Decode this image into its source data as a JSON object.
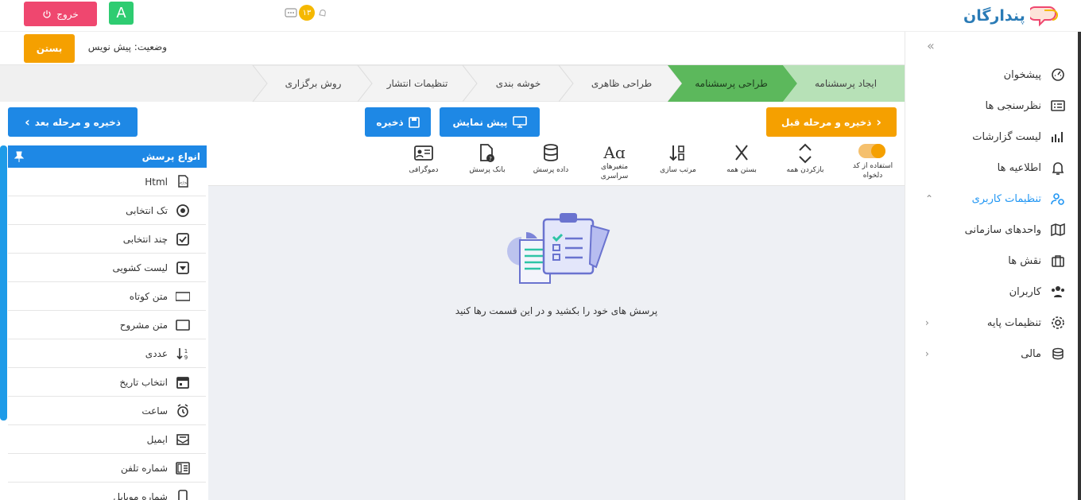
{
  "header": {
    "logout_label": "خروج",
    "avatar_letter": "A",
    "notification_count": "۱۳",
    "logo_text": "پندارگان"
  },
  "status": {
    "close_label": "بستن",
    "status_text": "وضعیت: پیش نویس"
  },
  "steps": [
    "ایجاد پرسشنامه",
    "طراحی پرسشنامه",
    "طراحی ظاهری",
    "خوشه بندی",
    "تنظیمات انتشار",
    "روش برگزاری"
  ],
  "actions": {
    "save_prev": "ذخیره و مرحله قبل",
    "preview": "پیش نمایش",
    "save": "ذخیره",
    "save_next": "ذخیره و مرحله بعد"
  },
  "tools": {
    "custom_code": "استفاده از کد دلخواه",
    "expand_all": "بازکردن همه",
    "collapse_all": "بستن همه",
    "sort": "مرتب سازی",
    "global_vars": "متغیرهای سراسری",
    "question_data": "داده پرسش",
    "question_bank": "بانک پرسش",
    "demographics": "دموگرافی"
  },
  "question_types": {
    "title": "انواع پرسش",
    "items": [
      {
        "label": "Html",
        "icon": "html-file-icon"
      },
      {
        "label": "تک انتخابی",
        "icon": "radio-icon"
      },
      {
        "label": "چند انتخابی",
        "icon": "checkbox-icon"
      },
      {
        "label": "لیست کشویی",
        "icon": "dropdown-icon"
      },
      {
        "label": "متن کوتاه",
        "icon": "short-text-icon"
      },
      {
        "label": "متن مشروح",
        "icon": "long-text-icon"
      },
      {
        "label": "عددی",
        "icon": "number-sort-icon"
      },
      {
        "label": "انتخاب تاریخ",
        "icon": "calendar-icon"
      },
      {
        "label": "ساعت",
        "icon": "alarm-clock-icon"
      },
      {
        "label": "ایمیل",
        "icon": "email-icon"
      },
      {
        "label": "شماره تلفن",
        "icon": "phone-icon"
      },
      {
        "label": "شماره موبایل",
        "icon": "mobile-icon"
      }
    ]
  },
  "empty_state": {
    "text": "پرسش های خود را بکشید و در این قسمت رها کنید"
  },
  "sidebar": {
    "items": [
      {
        "label": "پیشخوان",
        "icon": "dashboard-icon"
      },
      {
        "label": "نظرسنجی ها",
        "icon": "survey-list-icon"
      },
      {
        "label": "لیست گزارشات",
        "icon": "chart-icon"
      },
      {
        "label": "اطلاعیه ها",
        "icon": "bell-icon"
      },
      {
        "label": "تنظیمات کاربری",
        "icon": "user-settings-icon"
      },
      {
        "label": "واحدهای سازمانی",
        "icon": "map-icon"
      },
      {
        "label": "نقش ها",
        "icon": "briefcase-icon"
      },
      {
        "label": "کاربران",
        "icon": "users-icon"
      },
      {
        "label": "تنظیمات پایه",
        "icon": "gear-icon"
      },
      {
        "label": "مالی",
        "icon": "coins-icon"
      }
    ]
  },
  "colors": {
    "primary": "#1e88e5",
    "accent": "#f5a000",
    "danger": "#ef476f",
    "active_step": "#5cb85c",
    "active_sidebar": "#2196f3"
  }
}
